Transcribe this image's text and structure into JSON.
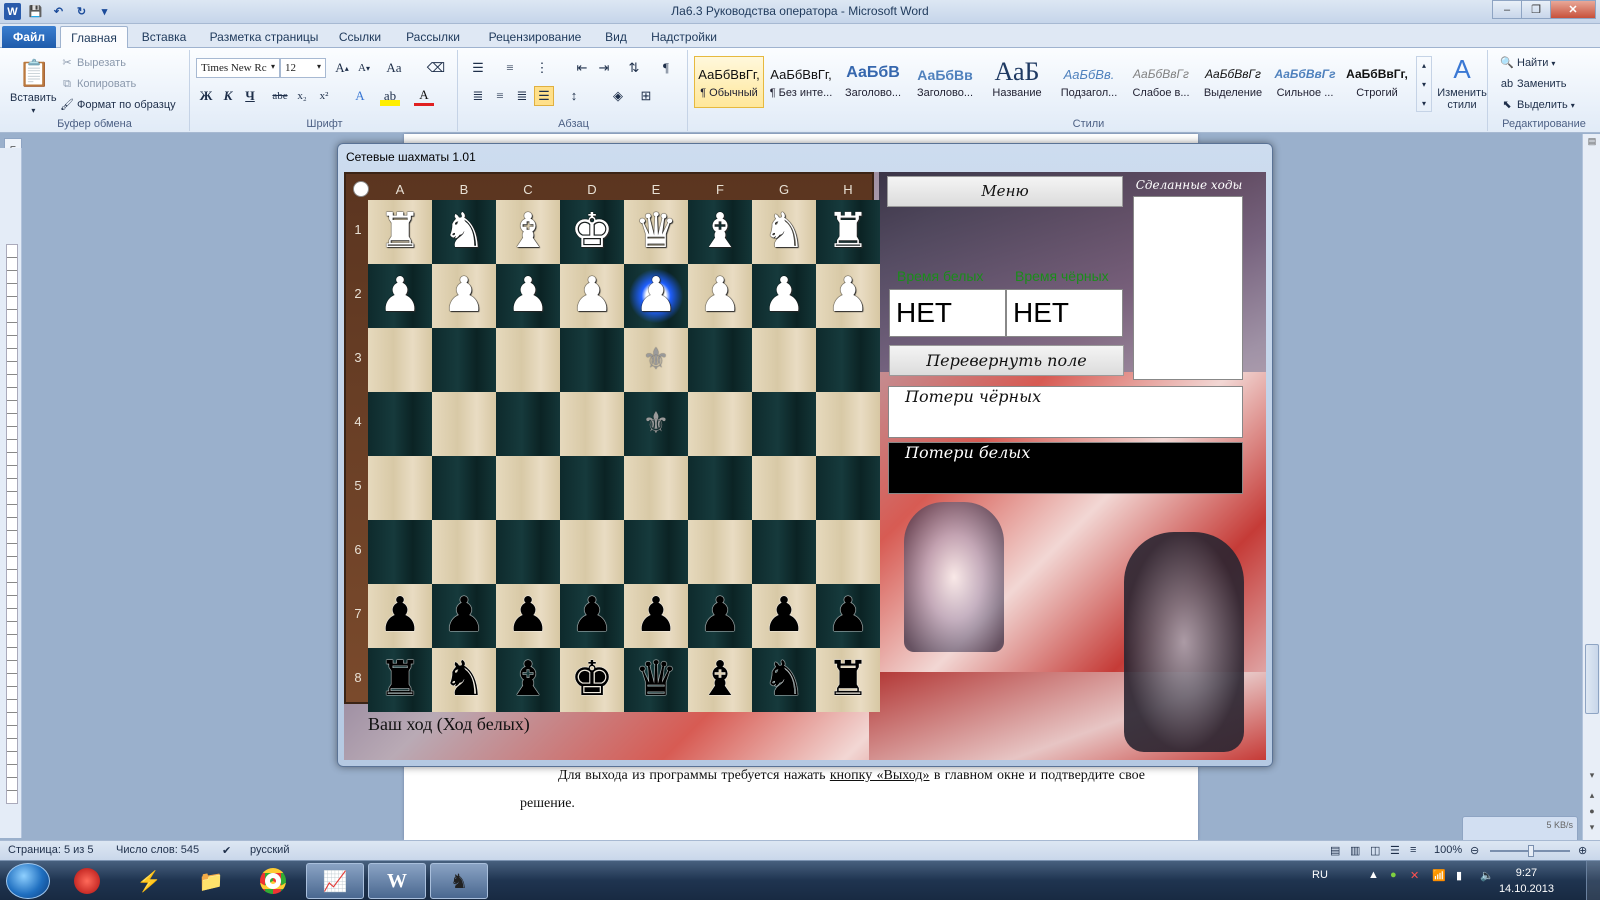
{
  "titlebar": {
    "title": "Ла6.3 Руководства оператора  -  Microsoft Word",
    "app_icon": "W",
    "buttons": [
      "–",
      "❐",
      "✕"
    ]
  },
  "ribbon_tabs": [
    "Файл",
    "Главная",
    "Вставка",
    "Разметка страницы",
    "Ссылки",
    "Рассылки",
    "Рецензирование",
    "Вид",
    "Надстройки"
  ],
  "clipboard": {
    "paste": "Вставить",
    "cut": "Вырезать",
    "copy": "Копировать",
    "format_painter": "Формат по образцу",
    "label": "Буфер обмена"
  },
  "font": {
    "name": "Times New Rc",
    "size": "12",
    "label": "Шрифт"
  },
  "paragraph": {
    "label": "Абзац"
  },
  "styles": {
    "label": "Стили",
    "items": [
      {
        "preview": "АаБбВвГг,",
        "name": "¶ Обычный"
      },
      {
        "preview": "АаБбВвГг,",
        "name": "¶ Без инте..."
      },
      {
        "preview": "АаБбВ",
        "name": "Заголово..."
      },
      {
        "preview": "АаБбВв",
        "name": "Заголово..."
      },
      {
        "preview": "АаБ",
        "name": "Название"
      },
      {
        "preview": "АаБбВв.",
        "name": "Подзагол..."
      },
      {
        "preview": "АаБбВвГг",
        "name": "Слабое в..."
      },
      {
        "preview": "АаБбВвГг",
        "name": "Выделение"
      },
      {
        "preview": "АаБбВвГг",
        "name": "Сильное ..."
      },
      {
        "preview": "АаБбВвГг,",
        "name": "Строгий"
      }
    ],
    "change_styles": "Изменить стили"
  },
  "editing": {
    "find": "Найти",
    "replace": "Заменить",
    "select": "Выделить",
    "label": "Редактирование"
  },
  "chess": {
    "window_title": "Сетевые шахматы 1.01",
    "columns": [
      "A",
      "B",
      "C",
      "D",
      "E",
      "F",
      "G",
      "H"
    ],
    "rows": [
      "1",
      "2",
      "3",
      "4",
      "5",
      "6",
      "7",
      "8"
    ],
    "pieces": [
      [
        "♜",
        "♞",
        "♝",
        "♚",
        "♛",
        "♝",
        "♞",
        "♜"
      ],
      [
        "♟",
        "♟",
        "♟",
        "♟",
        "♟",
        "♟",
        "♟",
        "♟"
      ],
      [
        "",
        "",
        "",
        "",
        "",
        "",
        "",
        ""
      ],
      [
        "",
        "",
        "",
        "",
        "",
        "",
        "",
        ""
      ],
      [
        "",
        "",
        "",
        "",
        "",
        "",
        "",
        ""
      ],
      [
        "",
        "",
        "",
        "",
        "",
        "",
        "",
        ""
      ],
      [
        "♟",
        "♟",
        "♟",
        "♟",
        "♟",
        "♟",
        "♟",
        "♟"
      ],
      [
        "♜",
        "♞",
        "♝",
        "♚",
        "♛",
        "♝",
        "♞",
        "♜"
      ]
    ],
    "piece_colors": [
      "white",
      "white",
      "",
      "",
      "",
      "",
      "black",
      "black"
    ],
    "selected": {
      "row": 2,
      "col": "E"
    },
    "move_hints": [
      {
        "row": 3,
        "col": "E"
      },
      {
        "row": 4,
        "col": "E"
      }
    ],
    "hint_symbol": "⚜",
    "status": "Ваш ход (Ход белых)",
    "menu": "Меню",
    "moves_label": "Сделанные ходы",
    "white_time_label": "Время белых",
    "black_time_label": "Время чёрных",
    "white_time": "НЕТ",
    "black_time": "НЕТ",
    "flip": "Перевернуть поле",
    "black_losses": "Потери чёрных",
    "white_losses": "Потери белых"
  },
  "document": {
    "text_a": "Для выхода из программы требуется нажать ",
    "link": "кнопку «Выход»",
    "text_b": " в главном окне и подтвердите свое решение."
  },
  "statusbar": {
    "page": "Страница: 5 из 5",
    "words": "Число слов: 545",
    "lang": "русский",
    "zoom": "100%"
  },
  "network": {
    "speed": "5 KB/s"
  },
  "tray": {
    "lang": "RU",
    "time": "9:27",
    "date": "14.10.2013"
  },
  "colors": {
    "file_tab": "#2a6cc0",
    "time_label": "#1a8d1a",
    "selected_glow": "#1f5fff"
  }
}
